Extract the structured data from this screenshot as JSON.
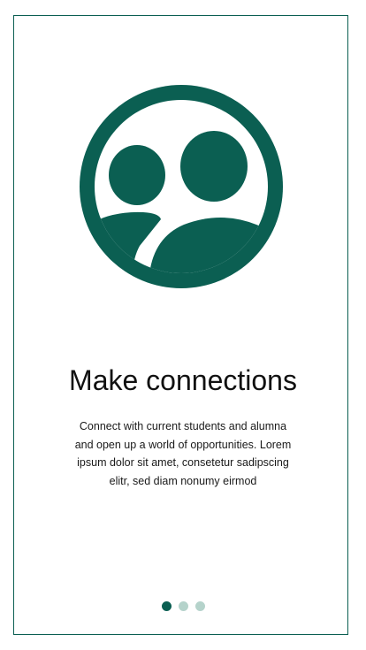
{
  "onboarding": {
    "title": "Make connections",
    "description": "Connect with current students and alumna and open up a world of opportunities. Lorem ipsum dolor sit amet, consetetur sadipscing elitr, sed diam nonumy eirmod",
    "illustration_icon": "people-group-icon",
    "pagination": {
      "total": 3,
      "current": 1
    }
  },
  "colors": {
    "accent": "#0b5f52",
    "dot_inactive": "#b5d3cb",
    "border": "#0b5f52"
  }
}
